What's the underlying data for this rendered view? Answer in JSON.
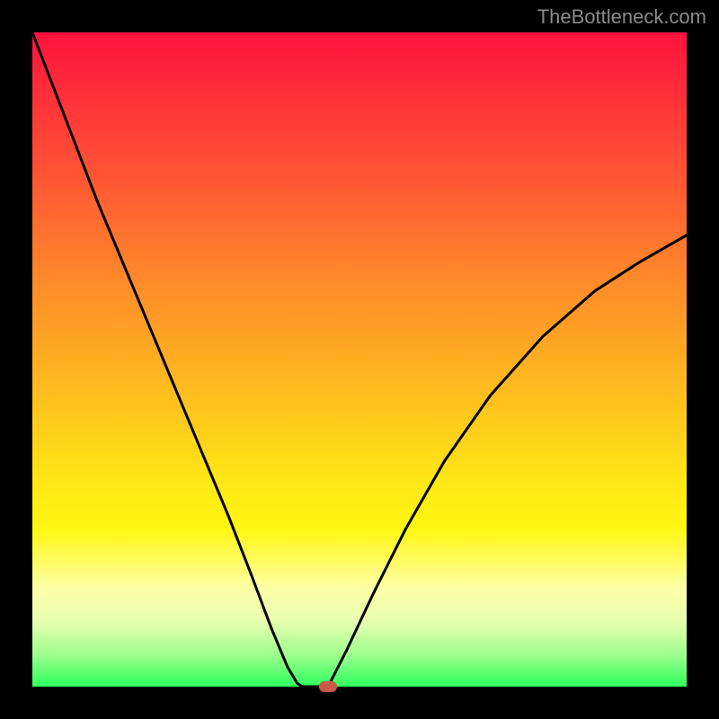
{
  "watermark": "TheBottleneck.com",
  "chart_data": {
    "type": "line",
    "title": "",
    "xlabel": "",
    "ylabel": "",
    "xlim": [
      0,
      1
    ],
    "ylim": [
      0,
      1
    ],
    "grid": false,
    "legend": false,
    "axes_visible": false,
    "background": {
      "gradient": "vertical",
      "stops": [
        {
          "pos": 0.0,
          "color": "#ff123e"
        },
        {
          "pos": 0.22,
          "color": "#ff5534"
        },
        {
          "pos": 0.55,
          "color": "#ffbd1f"
        },
        {
          "pos": 0.76,
          "color": "#fff714"
        },
        {
          "pos": 0.9,
          "color": "#e8ffb0"
        },
        {
          "pos": 1.0,
          "color": "#2fff5e"
        }
      ]
    },
    "series": [
      {
        "name": "left-branch",
        "x": [
          0.0,
          0.05,
          0.1,
          0.15,
          0.2,
          0.25,
          0.3,
          0.335,
          0.365,
          0.39,
          0.405,
          0.413
        ],
        "y": [
          1.0,
          0.87,
          0.74,
          0.62,
          0.5,
          0.38,
          0.26,
          0.17,
          0.09,
          0.03,
          0.005,
          0.0
        ]
      },
      {
        "name": "bottom-flat",
        "x": [
          0.413,
          0.452
        ],
        "y": [
          0.0,
          0.0
        ]
      },
      {
        "name": "right-branch",
        "x": [
          0.452,
          0.48,
          0.52,
          0.57,
          0.63,
          0.7,
          0.78,
          0.86,
          0.93,
          1.0
        ],
        "y": [
          0.0,
          0.055,
          0.14,
          0.24,
          0.345,
          0.445,
          0.535,
          0.605,
          0.65,
          0.69
        ]
      }
    ],
    "marker": {
      "x": 0.452,
      "y": 0.0,
      "color": "#c85a4a",
      "shape": "rounded-rect"
    }
  },
  "colors": {
    "frame": "#000000",
    "curve": "#000000",
    "watermark": "#8a8a8a"
  }
}
